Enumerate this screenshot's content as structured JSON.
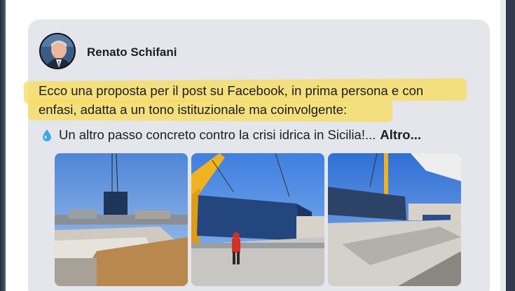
{
  "post": {
    "author": "Renato Schifani",
    "text_line1": "Ecco una proposta per il post su Facebook, in prima persona e con",
    "text_line2": "enfasi, adatta a un tono istituzionale ma coinvolgente:",
    "text_line3": "Un altro passo concreto contro la crisi idrica in Sicilia!...",
    "more_label": "Altro...",
    "highlight_color": "#f5d74a",
    "icons": [
      "water-drop-icon"
    ]
  },
  "photos": [
    {
      "subject": "container being lifted above construction site"
    },
    {
      "subject": "crane lifting blue shipping container, worker in red"
    },
    {
      "subject": "container lowered next to concrete slab"
    }
  ]
}
